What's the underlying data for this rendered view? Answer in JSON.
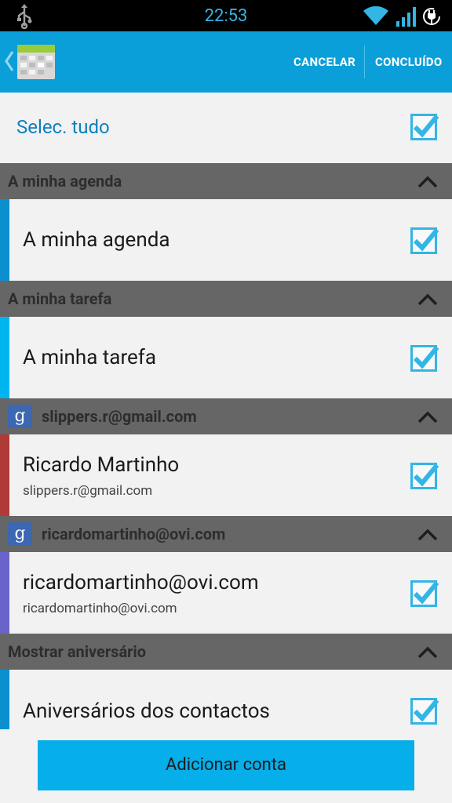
{
  "status": {
    "time": "22:53"
  },
  "actionbar": {
    "cancel": "CANCELAR",
    "done": "CONCLUÍDO"
  },
  "select_all": {
    "label": "Selec. tudo",
    "checked": true
  },
  "groups": [
    {
      "header": "A minha agenda",
      "google": false,
      "item": {
        "title": "A minha agenda",
        "subtitle": "",
        "color": "#0b8fcf",
        "checked": true
      }
    },
    {
      "header": "A minha tarefa",
      "google": false,
      "item": {
        "title": "A minha tarefa",
        "subtitle": "",
        "color": "#00b4f0",
        "checked": true
      }
    },
    {
      "header": "slippers.r@gmail.com",
      "google": true,
      "item": {
        "title": "Ricardo Martinho",
        "subtitle": "slippers.r@gmail.com",
        "color": "#b03a36",
        "checked": true
      }
    },
    {
      "header": "ricardomartinho@ovi.com",
      "google": true,
      "item": {
        "title": "ricardomartinho@ovi.com",
        "subtitle": "ricardomartinho@ovi.com",
        "color": "#6a63c9",
        "checked": true
      }
    },
    {
      "header": "Mostrar aniversário",
      "google": false,
      "item": {
        "title": "Aniversários dos contactos",
        "subtitle": "",
        "color": "#0b8fcf",
        "checked": true
      }
    }
  ],
  "google_icon_letter": "g",
  "bottom": {
    "add_account": "Adicionar conta"
  },
  "colors": {
    "accent": "#0a9fd8",
    "header_bg": "#666666",
    "checkbox": "#33b5e5"
  }
}
